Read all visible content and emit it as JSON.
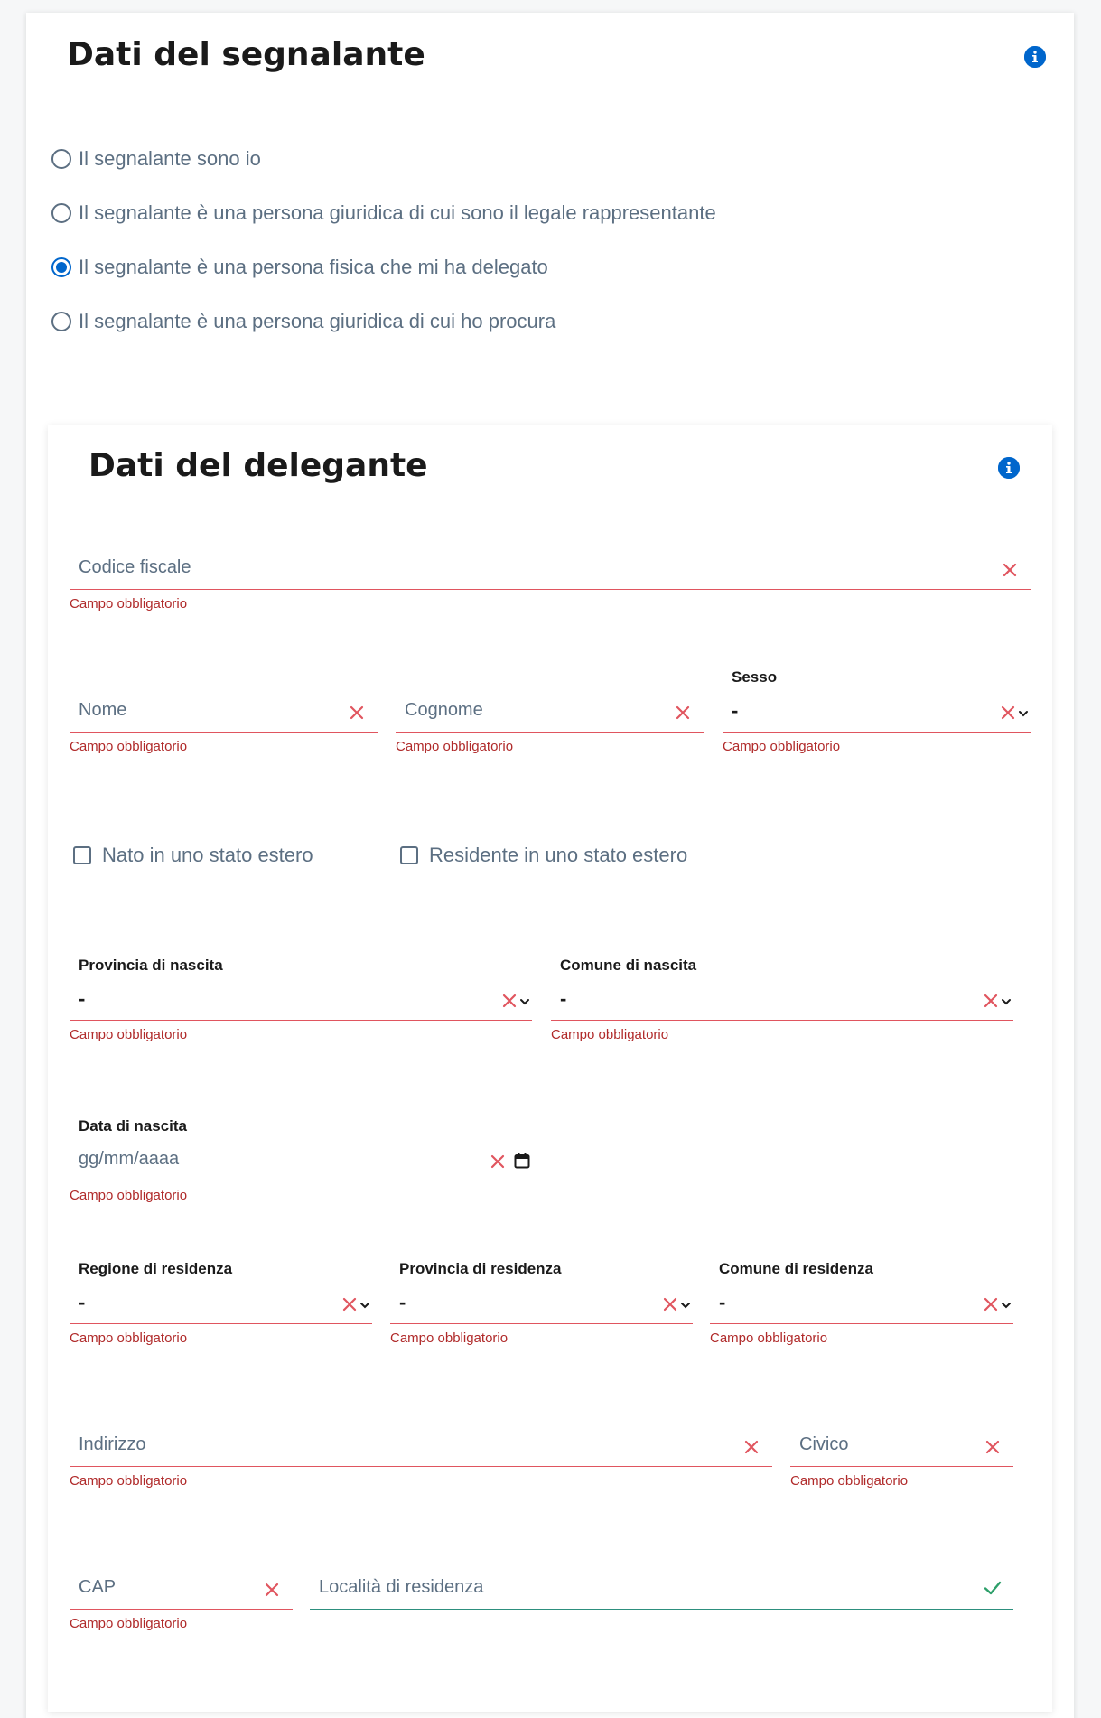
{
  "segnalante": {
    "title": "Dati del segnalante",
    "options": [
      {
        "label": "Il segnalante sono io",
        "checked": false
      },
      {
        "label": "Il segnalante è una persona giuridica di cui sono il legale rappresentante",
        "checked": false
      },
      {
        "label": "Il segnalante è una persona fisica che mi ha delegato",
        "checked": true
      },
      {
        "label": "Il segnalante è una persona giuridica di cui ho procura",
        "checked": false
      }
    ]
  },
  "delegante": {
    "title": "Dati del delegante",
    "required_msg": "Campo obbligatorio",
    "codice_fiscale": {
      "placeholder": "Codice fiscale"
    },
    "nome": {
      "placeholder": "Nome"
    },
    "cognome": {
      "placeholder": "Cognome"
    },
    "sesso": {
      "label": "Sesso",
      "value": "-"
    },
    "nato_estero": {
      "label": "Nato in uno stato estero",
      "checked": false
    },
    "residente_estero": {
      "label": "Residente in uno stato estero",
      "checked": false
    },
    "provincia_nascita": {
      "label": "Provincia di nascita",
      "value": "-"
    },
    "comune_nascita": {
      "label": "Comune di nascita",
      "value": "-"
    },
    "data_nascita": {
      "label": "Data di nascita",
      "placeholder": "gg/mm/aaaa"
    },
    "regione_residenza": {
      "label": "Regione di residenza",
      "value": "-"
    },
    "provincia_residenza": {
      "label": "Provincia di residenza",
      "value": "-"
    },
    "comune_residenza": {
      "label": "Comune di residenza",
      "value": "-"
    },
    "indirizzo": {
      "placeholder": "Indirizzo"
    },
    "civico": {
      "placeholder": "Civico"
    },
    "cap": {
      "placeholder": "CAP"
    },
    "localita": {
      "placeholder": "Località di residenza"
    }
  },
  "colors": {
    "accent": "#0066cc",
    "error": "#e0555f",
    "error_text": "#b02a2a",
    "valid": "#2d8f7e",
    "muted_text": "#5c6f82"
  },
  "icons": {
    "info": "info-icon",
    "clear": "close-icon",
    "dropdown": "chevron-down-icon",
    "calendar": "calendar-icon",
    "valid": "check-icon"
  }
}
